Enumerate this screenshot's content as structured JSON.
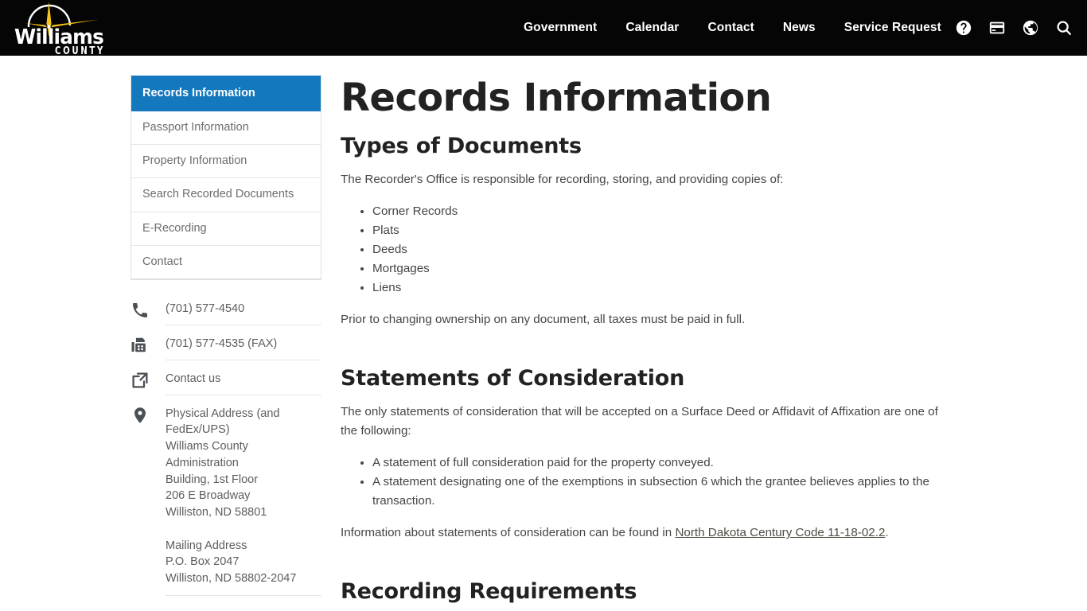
{
  "header": {
    "logo": {
      "line1": "Williams",
      "line2": "COUNTY",
      "icon": "compass-starburst-icon",
      "gold": "#f5c518",
      "background": "#050505"
    },
    "nav": [
      {
        "label": "Government"
      },
      {
        "label": "Calendar"
      },
      {
        "label": "Contact"
      },
      {
        "label": "News"
      },
      {
        "label": "Service Request"
      }
    ],
    "utility_icons": [
      {
        "name": "help-icon"
      },
      {
        "name": "credit-card-icon"
      },
      {
        "name": "globe-icon"
      },
      {
        "name": "search-icon"
      }
    ]
  },
  "sidebar": {
    "nav_items": [
      {
        "label": "Records Information",
        "active": true
      },
      {
        "label": "Passport Information",
        "active": false
      },
      {
        "label": "Property Information",
        "active": false
      },
      {
        "label": "Search Recorded Documents",
        "active": false
      },
      {
        "label": "E-Recording",
        "active": false
      },
      {
        "label": "Contact",
        "active": false
      }
    ],
    "active_color": "#1378be",
    "contact": {
      "phone": "(701) 577-4540",
      "fax": "(701) 577-4535 (FAX)",
      "contact_link": "Contact us",
      "address": {
        "physical_label": "Physical Address (and",
        "physical_label2": "FedEx/UPS)",
        "line1": "Williams County Administration",
        "line2": "Building, 1st Floor",
        "line3": "206 E Broadway",
        "line4": "Williston, ND 58801",
        "mailing_label": "Mailing Address",
        "mail1": "P.O. Box 2047",
        "mail2": "Williston, ND 58802-2047"
      }
    }
  },
  "main": {
    "title": "Records Information",
    "sections": [
      {
        "heading": "Types of Documents",
        "intro": "The Recorder's Office is responsible for recording, storing, and providing copies of:",
        "list": [
          "Corner Records",
          "Plats",
          "Deeds",
          "Mortgages",
          "Liens"
        ],
        "outro": "Prior to changing ownership on any document, all taxes must be paid in full."
      },
      {
        "heading": "Statements of Consideration",
        "intro": "The only statements of consideration that will be accepted on a Surface Deed or Affidavit of Affixation are one of the following:",
        "list": [
          "A statement of full consideration paid for the property conveyed.",
          "A statement designating one of the exemptions in subsection 6 which the grantee believes applies to the transaction."
        ],
        "outro_pre": "Information about statements of consideration can be found in ",
        "outro_link": "North Dakota Century Code 11-18-02.2",
        "outro_post": "."
      },
      {
        "heading": "Recording Requirements"
      }
    ]
  }
}
